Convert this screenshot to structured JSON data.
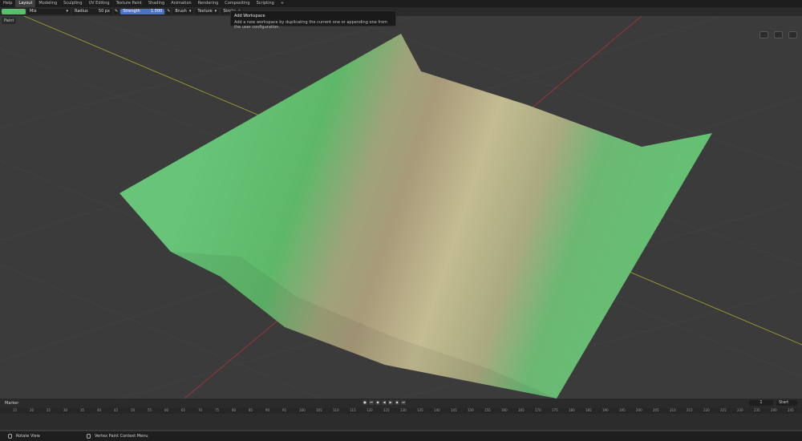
{
  "menu": {
    "help": "Help"
  },
  "workspace_tabs": [
    "Layout",
    "Modeling",
    "Sculpting",
    "UV Editing",
    "Texture Paint",
    "Shading",
    "Animation",
    "Rendering",
    "Compositing",
    "Scripting"
  ],
  "add_tab": "+",
  "toolbar": {
    "blend_mode": "Mix",
    "radius_label": "Radius",
    "radius_value": "50 px",
    "strength_label": "Strength",
    "strength_value": "1.000",
    "brush": "Brush",
    "texture": "Texture",
    "stroke": "Stroke"
  },
  "viewport": {
    "mode_label": "Paint"
  },
  "tooltip": {
    "title": "Add Workspace",
    "description": "Add a new workspace by duplicating the current one or appending one from the user configuration."
  },
  "timeline": {
    "marker": "Marker",
    "current_frame": "1",
    "start_label": "Start",
    "ticks": [
      "15",
      "20",
      "25",
      "30",
      "35",
      "40",
      "45",
      "50",
      "55",
      "60",
      "65",
      "70",
      "75",
      "80",
      "85",
      "90",
      "95",
      "100",
      "105",
      "110",
      "115",
      "120",
      "125",
      "130",
      "135",
      "140",
      "145",
      "150",
      "155",
      "160",
      "165",
      "170",
      "175",
      "180",
      "185",
      "190",
      "195",
      "200",
      "205",
      "210",
      "215",
      "220",
      "225",
      "230",
      "235",
      "240",
      "245"
    ]
  },
  "statusbar": {
    "rotate": "Rotate View",
    "context": "Vertex Paint Context Menu"
  },
  "colors": {
    "terrain_green": "#5fbf6c",
    "path_tan": "#b9b187",
    "grid_red": "#b33a3a",
    "grid_yellow": "#a4a234"
  }
}
